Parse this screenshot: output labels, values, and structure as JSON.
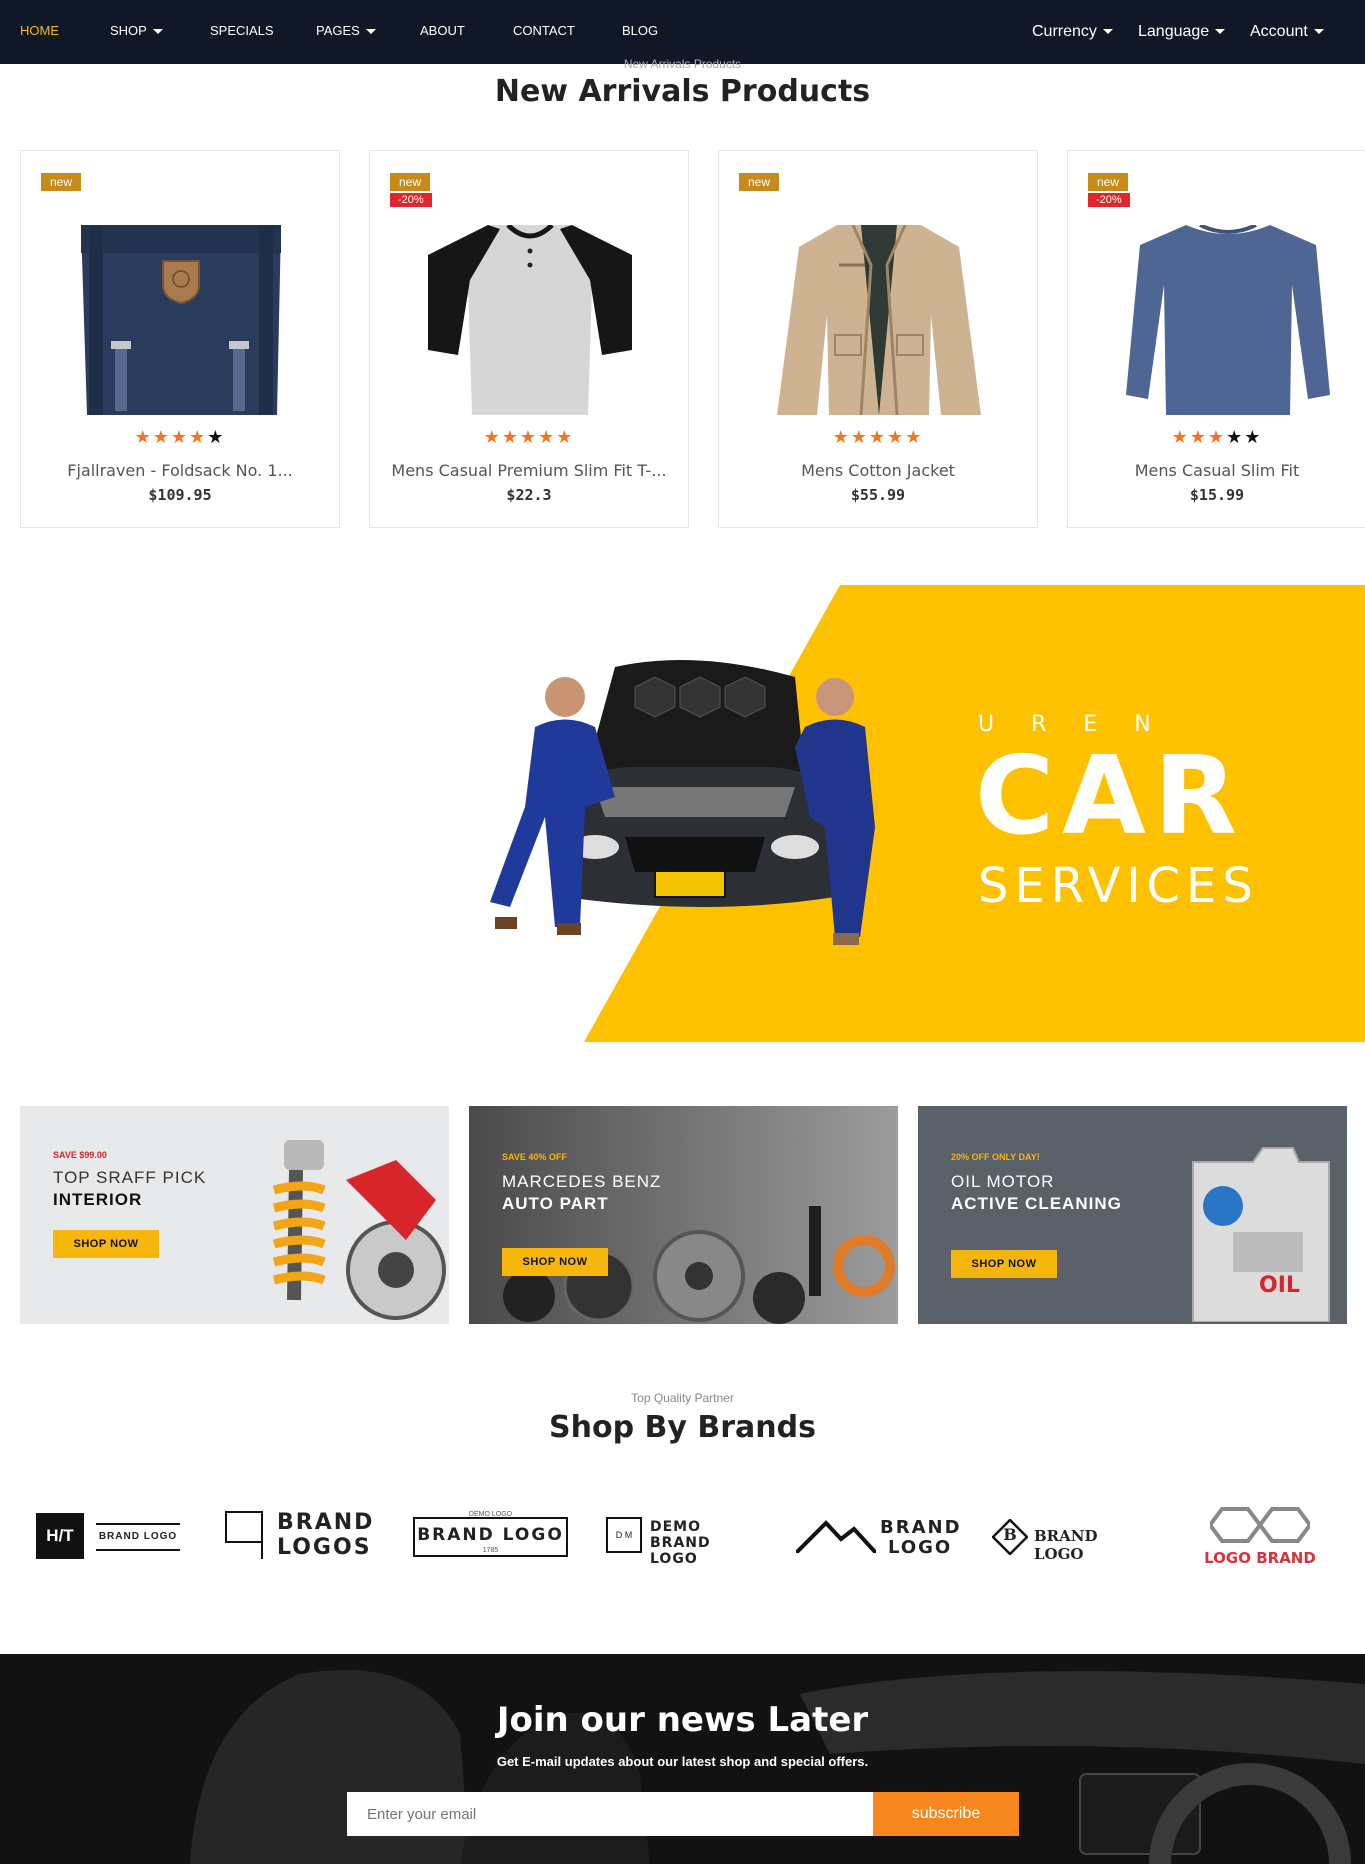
{
  "nav": {
    "items": [
      {
        "label": "HOME",
        "dropdown": false,
        "active": true
      },
      {
        "label": "SHOP",
        "dropdown": true,
        "active": false
      },
      {
        "label": "SPECIALS",
        "dropdown": false,
        "active": false
      },
      {
        "label": "PAGES",
        "dropdown": true,
        "active": false
      },
      {
        "label": "ABOUT",
        "dropdown": false,
        "active": false
      },
      {
        "label": "CONTACT",
        "dropdown": false,
        "active": false
      },
      {
        "label": "BLOG",
        "dropdown": false,
        "active": false
      }
    ],
    "right": [
      {
        "label": "Currency"
      },
      {
        "label": "Language"
      },
      {
        "label": "Account"
      }
    ],
    "background_color": "#101828",
    "active_color": "#f6b60c"
  },
  "new_arrivals": {
    "eyebrow": "New Arrivals Products",
    "title": "New Arrivals Products",
    "products": [
      {
        "badge": "new",
        "sale": "",
        "rating": 4,
        "name": "Fjallraven - Foldsack No. 1...",
        "price": "$109.95",
        "image": "backpack"
      },
      {
        "badge": "new",
        "sale": "-20%",
        "rating": 5,
        "name": "Mens Casual Premium Slim Fit T-...",
        "price": "$22.3",
        "image": "raglan-tshirt"
      },
      {
        "badge": "new",
        "sale": "",
        "rating": 5,
        "name": "Mens Cotton Jacket",
        "price": "$55.99",
        "image": "cotton-jacket"
      },
      {
        "badge": "new",
        "sale": "-20%",
        "rating": 3,
        "name": "Mens Casual Slim Fit",
        "price": "$15.99",
        "image": "longsleeve"
      }
    ]
  },
  "hero": {
    "brand_small": "UREN",
    "brand_big": "CAR",
    "brand_sub": "SERVICES",
    "accent_color": "#fdc100"
  },
  "banners": [
    {
      "eyebrow": "SAVE $99.00",
      "line1": "TOP SRAFF PICK",
      "line2": "INTERIOR",
      "button": "SHOP NOW"
    },
    {
      "eyebrow": "SAVE 40% OFF",
      "line1": "MARCEDES BENZ",
      "line2": "AUTO PART",
      "button": "SHOP NOW"
    },
    {
      "eyebrow": "20% OFF ONLY DAY!",
      "line1": "OIL MOTOR",
      "line2": "ACTIVE CLEANING",
      "button": "SHOP NOW"
    }
  ],
  "brands_section": {
    "eyebrow": "Top Quality Partner",
    "title": "Shop By Brands",
    "brands": [
      {
        "mark": "H/T",
        "text": "BRAND LOGO"
      },
      {
        "text1": "BRAND",
        "text2": "LOGOS"
      },
      {
        "small": "DEMO LOGO",
        "text": "BRAND LOGO",
        "year": "1785"
      },
      {
        "mark": "D M",
        "text1": "DEMO",
        "text2": "BRAND LOGO"
      },
      {
        "text1": "BRAND",
        "text2": "LOGO"
      },
      {
        "mark": "B",
        "text": "BRAND LOGO"
      },
      {
        "text": "LOGO BRAND"
      }
    ]
  },
  "newsletter": {
    "title": "Join our news Later",
    "subtitle": "Get E-mail updates about our latest shop and special offers.",
    "placeholder": "Enter your email",
    "button": "subscribe",
    "button_color": "#f6871f"
  }
}
